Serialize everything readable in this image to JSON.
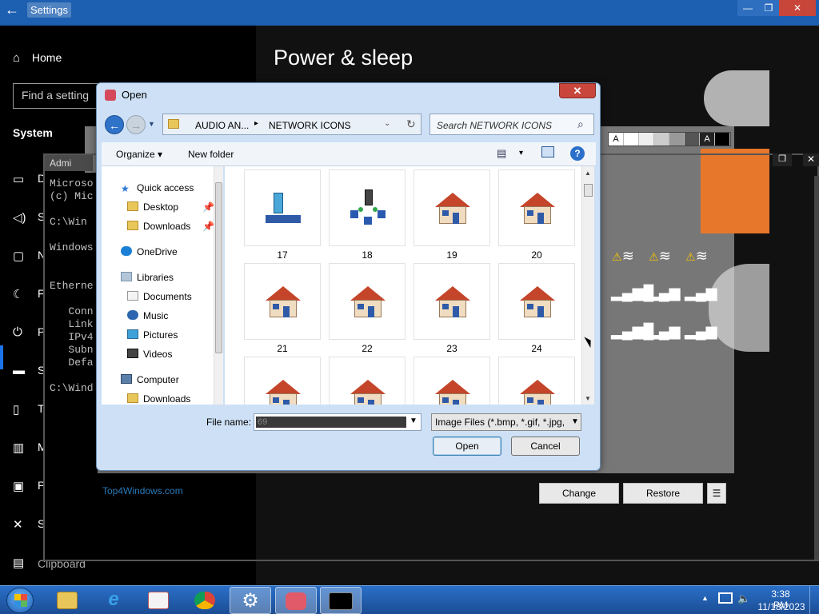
{
  "settings": {
    "window_title": "Settings",
    "back_glyph": "←",
    "min_glyph": "—",
    "max_glyph": "❐",
    "close_glyph": "✕",
    "home_label": "Home",
    "home_icon": "home-icon",
    "search_placeholder": "Find a setting",
    "category": "System",
    "page_title": "Power & sleep",
    "nav_letters": [
      "D",
      "S",
      "N",
      "F",
      "P",
      "S",
      "T",
      "M",
      "P",
      "S"
    ],
    "clipboard_label": "Clipboard",
    "accent_color": "#1a73e8"
  },
  "background_panel": {
    "strip_labels": [
      "A",
      "",
      "",
      "",
      "",
      "",
      "A",
      ""
    ],
    "change_label": "Change",
    "restore_label": "Restore",
    "menu_glyph": "☰",
    "watermark": "Top4Windows.com"
  },
  "cmd": {
    "title": "Admi",
    "max_glyph": "❐",
    "close_glyph": "✕",
    "lines": [
      "Microso",
      "(c) Mic",
      "",
      "C:\\Win",
      "",
      "Windows",
      "",
      "",
      "Etherne",
      "",
      "   Conn",
      "   Link",
      "   IPv4",
      "   Subn",
      "   Defa",
      "",
      "C:\\Wind"
    ]
  },
  "dialog": {
    "title": "Open",
    "close_glyph": "✕",
    "address": {
      "segment1": "AUDIO AN...",
      "separator": "▸",
      "segment2": "NETWORK ICONS",
      "dropdown_glyph": "⌄",
      "refresh_glyph": "↻"
    },
    "search_placeholder": "Search NETWORK ICONS",
    "toolbar": {
      "organize_label": "Organize ▾",
      "new_folder_label": "New folder",
      "views_glyph": "▤",
      "views_drop": "▾",
      "help_glyph": "?"
    },
    "nav_pane": [
      {
        "label": "Quick access",
        "icon": "star-icon"
      },
      {
        "label": "Desktop",
        "icon": "folder-icon",
        "pinned": true
      },
      {
        "label": "Downloads",
        "icon": "folder-icon",
        "pinned": true
      },
      {
        "label": "OneDrive",
        "icon": "cloud-icon"
      },
      {
        "label": "Libraries",
        "icon": "library-icon"
      },
      {
        "label": "Documents",
        "icon": "document-icon"
      },
      {
        "label": "Music",
        "icon": "music-icon"
      },
      {
        "label": "Pictures",
        "icon": "pictures-icon"
      },
      {
        "label": "Videos",
        "icon": "videos-icon"
      },
      {
        "label": "Computer",
        "icon": "computer-icon"
      },
      {
        "label": "Downloads",
        "icon": "folder-icon"
      }
    ],
    "files": [
      {
        "name": "17",
        "icon": "network-user-icon"
      },
      {
        "name": "18",
        "icon": "network-hub-icon"
      },
      {
        "name": "19",
        "icon": "house-icon"
      },
      {
        "name": "20",
        "icon": "house-icon"
      },
      {
        "name": "21",
        "icon": "house-icon"
      },
      {
        "name": "22",
        "icon": "house-icon"
      },
      {
        "name": "23",
        "icon": "house-icon"
      },
      {
        "name": "24",
        "icon": "house-icon"
      },
      {
        "name": "",
        "icon": "house-icon"
      },
      {
        "name": "",
        "icon": "house-icon"
      },
      {
        "name": "",
        "icon": "house-icon"
      },
      {
        "name": "",
        "icon": "house-icon"
      }
    ],
    "file_name_label": "File name:",
    "file_name_value": "69",
    "filter_value": "Image Files (*.bmp, *.gif, *.jpg,",
    "open_label": "Open",
    "cancel_label": "Cancel"
  },
  "taskbar": {
    "items": [
      "file-explorer-icon",
      "internet-explorer-icon",
      "media-player-icon",
      "chrome-icon",
      "settings-gear-icon",
      "app-icon",
      "command-prompt-icon"
    ],
    "ie_glyph": "e",
    "gear_glyph": "⚙",
    "tray_up_glyph": "▲",
    "volume_glyph": "🔈",
    "time": "3:38 PM",
    "date": "11/18/2023"
  }
}
